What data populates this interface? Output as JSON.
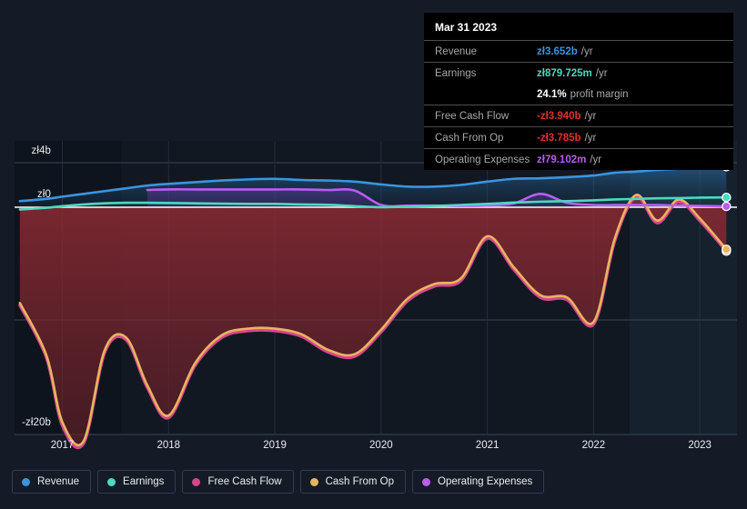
{
  "chart_data": {
    "type": "area",
    "title": "",
    "xlabel": "",
    "ylabel": "",
    "currency_symbol": "zł",
    "ylim": [
      -22.5,
      5.2
    ],
    "xlim": [
      2016.55,
      2023.35
    ],
    "grid": true,
    "legend_position": "bottom",
    "y_ticks": [
      {
        "label": "zł4b",
        "value": 4
      },
      {
        "label": "zł0",
        "value": 0
      },
      {
        "label": "-zł20b",
        "value": -20
      }
    ],
    "x_ticks": [
      {
        "label": "2017",
        "value": 2017
      },
      {
        "label": "2018",
        "value": 2018
      },
      {
        "label": "2019",
        "value": 2019
      },
      {
        "label": "2020",
        "value": 2020
      },
      {
        "label": "2021",
        "value": 2021
      },
      {
        "label": "2022",
        "value": 2022
      },
      {
        "label": "2023",
        "value": 2023
      }
    ],
    "x": [
      2016.6,
      2016.85,
      2017.0,
      2017.2,
      2017.4,
      2017.6,
      2017.8,
      2018.0,
      2018.25,
      2018.5,
      2018.75,
      2019.0,
      2019.25,
      2019.5,
      2019.75,
      2020.0,
      2020.25,
      2020.5,
      2020.75,
      2021.0,
      2021.25,
      2021.5,
      2021.75,
      2022.0,
      2022.2,
      2022.4,
      2022.6,
      2022.8,
      2023.0,
      2023.25
    ],
    "series": [
      {
        "name": "Revenue",
        "color": "#3a95e0",
        "fill": "#1d4a70",
        "values": [
          0.55,
          0.75,
          0.95,
          1.2,
          1.45,
          1.7,
          1.95,
          2.1,
          2.25,
          2.4,
          2.5,
          2.55,
          2.45,
          2.4,
          2.3,
          2.05,
          1.85,
          1.85,
          2.0,
          2.3,
          2.55,
          2.6,
          2.7,
          2.85,
          3.1,
          3.2,
          3.35,
          3.45,
          3.6,
          3.652
        ]
      },
      {
        "name": "Earnings",
        "color": "#4fd8c0",
        "fill": "#1f6a68",
        "values": [
          -0.2,
          -0.05,
          0.1,
          0.25,
          0.35,
          0.4,
          0.4,
          0.38,
          0.35,
          0.32,
          0.3,
          0.3,
          0.25,
          0.22,
          0.1,
          0.0,
          0.05,
          0.12,
          0.2,
          0.3,
          0.42,
          0.5,
          0.55,
          0.62,
          0.7,
          0.75,
          0.8,
          0.82,
          0.86,
          0.879725
        ]
      },
      {
        "name": "Free Cash Flow",
        "color": "#d6458c",
        "fill": "#7a2430",
        "values": [
          -8.8,
          -13.5,
          -19.6,
          -21.2,
          -13.0,
          -11.9,
          -16.2,
          -18.9,
          -14.2,
          -11.7,
          -11.1,
          -11.1,
          -11.6,
          -13.0,
          -13.4,
          -11.2,
          -8.4,
          -7.1,
          -6.6,
          -2.8,
          -5.6,
          -8.1,
          -8.3,
          -10.5,
          -3.0,
          0.9,
          -1.4,
          0.5,
          -1.2,
          -3.94
        ]
      },
      {
        "name": "Cash From Op",
        "color": "#e8b55e",
        "fill": "#7a2430",
        "values": [
          -8.6,
          -13.3,
          -19.3,
          -21.0,
          -12.8,
          -11.7,
          -16.0,
          -18.7,
          -14.0,
          -11.5,
          -10.9,
          -10.9,
          -11.4,
          -12.8,
          -13.2,
          -11.0,
          -8.2,
          -6.9,
          -6.4,
          -2.6,
          -5.4,
          -7.9,
          -8.1,
          -10.3,
          -2.8,
          1.1,
          -1.2,
          0.7,
          -1.0,
          -3.785
        ]
      },
      {
        "name": "Operating Expenses",
        "color": "#b85ef0",
        "fill": "#4a3580",
        "values": [
          null,
          null,
          null,
          null,
          null,
          null,
          1.55,
          1.6,
          1.6,
          1.6,
          1.6,
          1.6,
          1.6,
          1.55,
          1.5,
          0.2,
          0.15,
          0.15,
          0.12,
          0.15,
          0.35,
          1.2,
          0.4,
          0.2,
          0.2,
          0.2,
          0.2,
          0.15,
          0.12,
          0.079102
        ]
      }
    ]
  },
  "tooltip": {
    "date": "Mar 31 2023",
    "rows": [
      {
        "label": "Revenue",
        "value": "zł3.652b",
        "unit": "/yr",
        "color": "#3a95e0"
      },
      {
        "label": "Earnings",
        "value": "zł879.725m",
        "unit": "/yr",
        "color": "#4fd8c0"
      },
      {
        "label": "",
        "value": "24.1%",
        "unit": "profit margin",
        "color": "#ffffff"
      },
      {
        "label": "Free Cash Flow",
        "value": "-zł3.940b",
        "unit": "/yr",
        "color": "#e03030"
      },
      {
        "label": "Cash From Op",
        "value": "-zł3.785b",
        "unit": "/yr",
        "color": "#e03030"
      },
      {
        "label": "Operating Expenses",
        "value": "zł79.102m",
        "unit": "/yr",
        "color": "#b85ef0"
      }
    ]
  },
  "legend": {
    "items": [
      {
        "label": "Revenue",
        "color": "#3a95e0"
      },
      {
        "label": "Earnings",
        "color": "#4fd8c0"
      },
      {
        "label": "Free Cash Flow",
        "color": "#d6458c"
      },
      {
        "label": "Cash From Op",
        "color": "#e8b55e"
      },
      {
        "label": "Operating Expenses",
        "color": "#b85ef0"
      }
    ]
  }
}
